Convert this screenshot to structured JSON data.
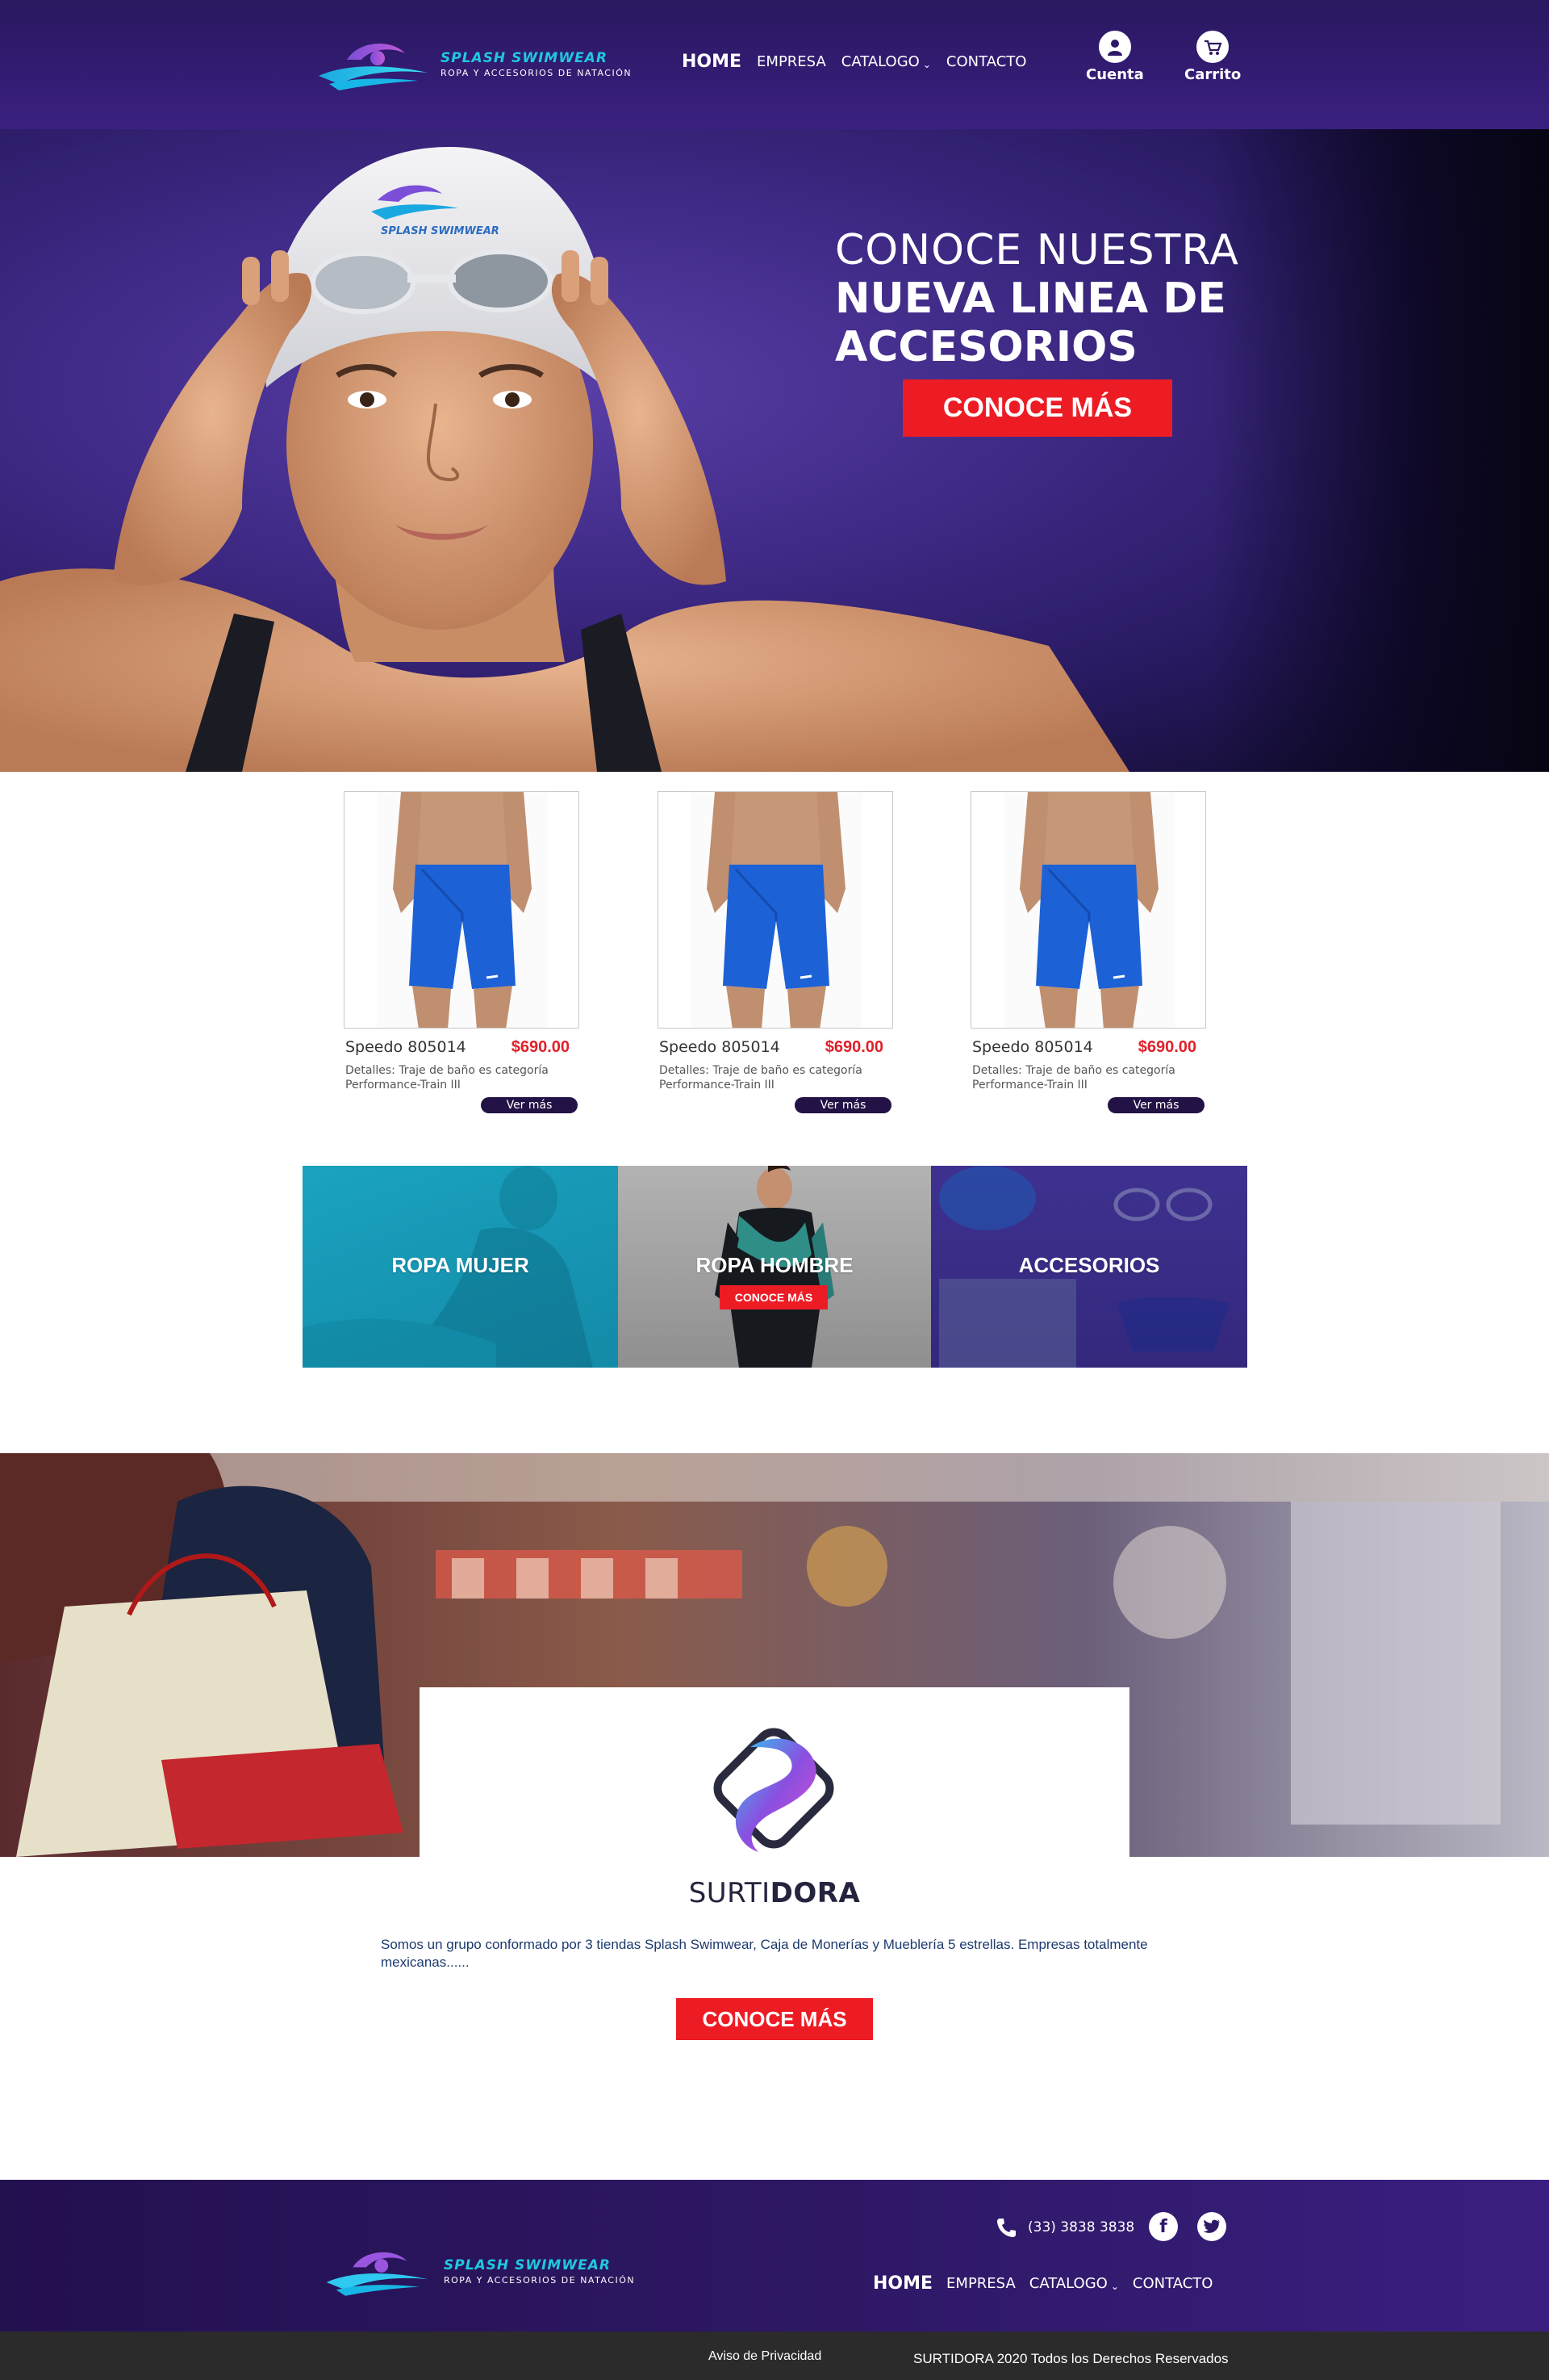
{
  "brand": {
    "name": "SPLASH SWIMWEAR",
    "tagline": "ROPA Y ACCESORIOS DE NATACIÓN",
    "cap_text": "SPLASH SWIMWEAR",
    "accent": "#20c8e0",
    "primary": "#2e1866",
    "cta_color": "#ed1c24"
  },
  "nav": {
    "items": [
      {
        "label": "HOME",
        "active": true
      },
      {
        "label": "EMPRESA"
      },
      {
        "label": "CATALOGO",
        "has_dropdown": true
      },
      {
        "label": "CONTACTO"
      }
    ]
  },
  "header": {
    "account_label": "Cuenta",
    "account_icon": "user-icon",
    "cart_label": "Carrito",
    "cart_icon": "cart-icon"
  },
  "hero": {
    "line1": "CONOCE NUESTRA",
    "line2": "NUEVA LINEA DE ACCESORIOS",
    "button": "CONOCE MÁS"
  },
  "products": [
    {
      "name": "Speedo 805014",
      "price": "$690.00",
      "details": "Detalles: Traje de baño es categoría Performance-Train III",
      "button": "Ver más"
    },
    {
      "name": "Speedo 805014",
      "price": "$690.00",
      "details": "Detalles: Traje de baño es categoría Performance-Train III",
      "button": "Ver más"
    },
    {
      "name": "Speedo 805014",
      "price": "$690.00",
      "details": "Detalles: Traje de baño es categoría Performance-Train III",
      "button": "Ver más"
    }
  ],
  "categories": [
    {
      "title": "ROPA MUJER",
      "color": "#1596b4"
    },
    {
      "title": "ROPA HOMBRE",
      "button": "CONOCE MÁS",
      "color": "#9a9a9a"
    },
    {
      "title": "ACCESORIOS",
      "color": "#3b2e8f"
    }
  ],
  "about": {
    "logo_name_light": "SURTI",
    "logo_name_bold": "DORA",
    "text": "Somos un grupo conformado por 3 tiendas Splash Swimwear, Caja de Monerías y Mueblería 5 estrellas. Empresas totalmente mexicanas......",
    "button": "CONOCE MÁS"
  },
  "footer": {
    "phone": "(33) 3838 3838",
    "phone_icon": "phone-icon",
    "social": [
      {
        "name": "facebook-icon",
        "glyph": "f"
      },
      {
        "name": "twitter-icon",
        "glyph": "t"
      }
    ],
    "privacy": "Aviso de Privacidad",
    "copyright": "SURTIDORA 2020 Todos los Derechos Reservados"
  }
}
